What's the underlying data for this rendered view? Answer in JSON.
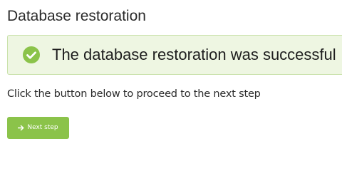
{
  "page": {
    "title": "Database restoration"
  },
  "alert": {
    "message": "The database restoration was successful",
    "icon": "check-circle-icon",
    "colors": {
      "background": "#eef6e2",
      "border": "#c9e1aa",
      "icon": "#8bc34a"
    }
  },
  "instruction": {
    "text": "Click the button below to proceed to the next step"
  },
  "next_button": {
    "label": "Next step",
    "icon": "arrow-right-icon",
    "color": "#8bc34a"
  }
}
